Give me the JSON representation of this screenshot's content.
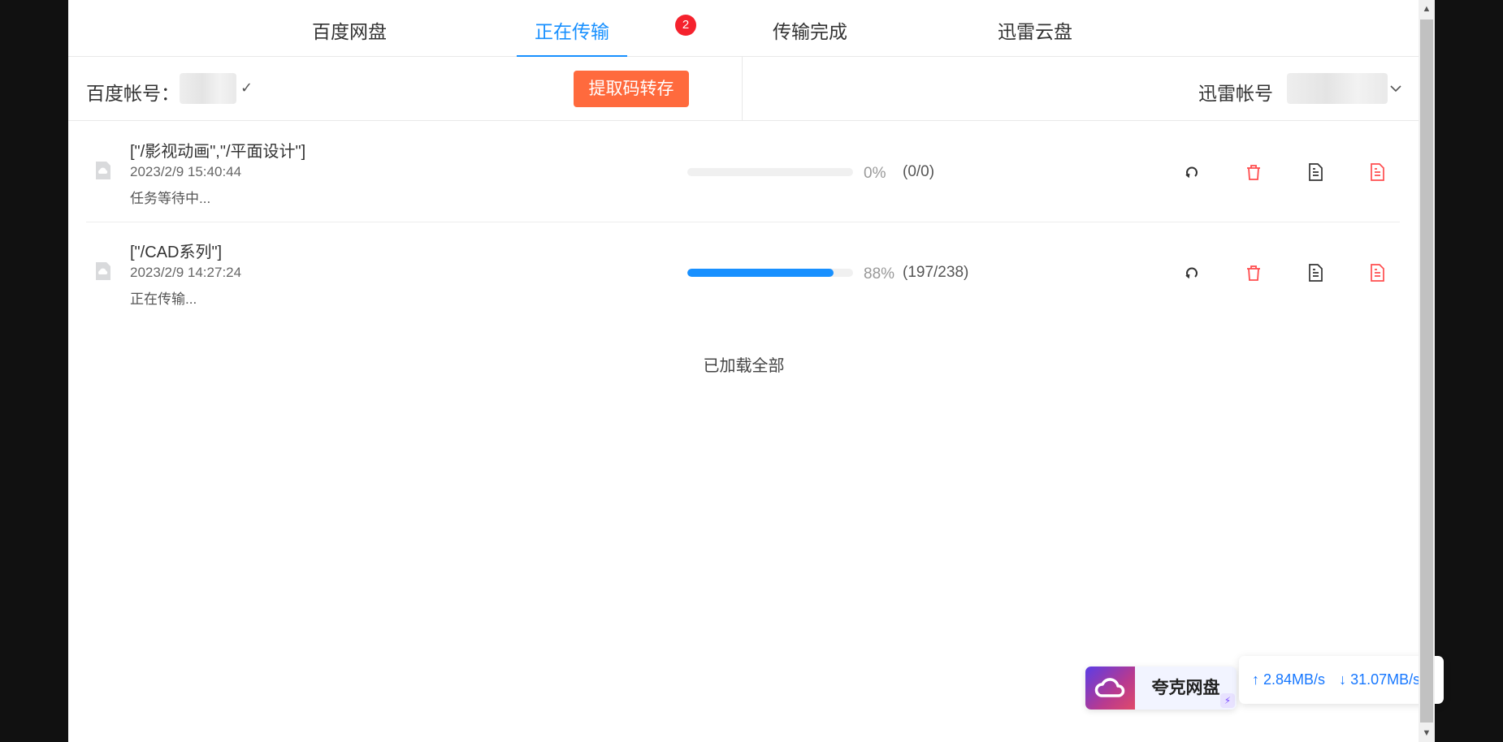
{
  "tabs": [
    {
      "label": "百度网盘",
      "active": false
    },
    {
      "label": "正在传输",
      "active": true,
      "badge": "2"
    },
    {
      "label": "传输完成",
      "active": false
    },
    {
      "label": "迅雷云盘",
      "active": false
    }
  ],
  "account_bar": {
    "baidu_label": "百度帐号：",
    "extract_button": "提取码转存",
    "xunlei_label": "迅雷帐号"
  },
  "tasks": [
    {
      "title": "[\"/影视动画\",\"/平面设计\"]",
      "time": "2023/2/9 15:40:44",
      "status": "任务等待中...",
      "progress": 0,
      "percent_text": "0%",
      "count_text": "(0/0)"
    },
    {
      "title": "[\"/CAD系列\"]",
      "time": "2023/2/9 14:27:24",
      "status": "正在传输...",
      "progress": 0.88,
      "percent_text": "88%",
      "count_text": "(197/238)"
    }
  ],
  "task_actions": [
    {
      "icon": "retry-icon",
      "color": "#333333"
    },
    {
      "icon": "delete-icon",
      "color": "#ff4d4f"
    },
    {
      "icon": "log-icon",
      "color": "#333333"
    },
    {
      "icon": "error-log-icon",
      "color": "#ff4d4f"
    }
  ],
  "footer_text": "已加载全部",
  "quark_widget": {
    "name": "夸克网盘",
    "upload_speed": "↑ 2.84MB/s",
    "download_speed": "↓ 31.07MB/s"
  },
  "colors": {
    "accent": "#1890ff",
    "extract_button": "#ff6a3d",
    "badge": "#f5222d",
    "danger": "#ff4d4f"
  }
}
